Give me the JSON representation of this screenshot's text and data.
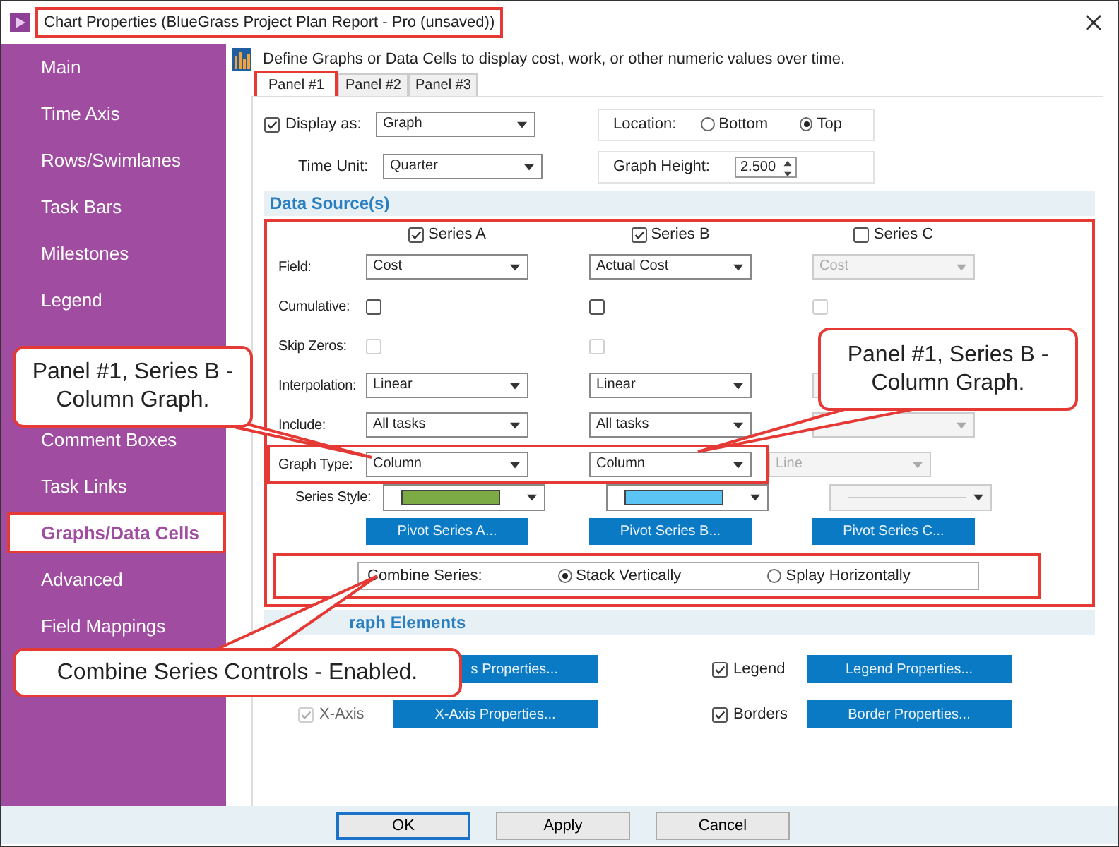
{
  "window": {
    "title": "Chart Properties (BlueGrass Project Plan Report - Pro (unsaved))",
    "highlighted": true
  },
  "sidebar": {
    "items": [
      {
        "label": "Main",
        "selected": false
      },
      {
        "label": "Time Axis",
        "selected": false
      },
      {
        "label": "Rows/Swimlanes",
        "selected": false
      },
      {
        "label": "Task Bars",
        "selected": false
      },
      {
        "label": "Milestones",
        "selected": false
      },
      {
        "label": "Legend",
        "selected": false
      },
      {
        "label": "Comment Boxes",
        "selected": false
      },
      {
        "label": "Task Links",
        "selected": false
      },
      {
        "label": "Graphs/Data Cells",
        "selected": true
      },
      {
        "label": "Advanced",
        "selected": false
      },
      {
        "label": "Field Mappings",
        "selected": false
      }
    ]
  },
  "intro": "Define Graphs or Data Cells to display cost, work, or other numeric values over time.",
  "tabs": [
    {
      "label": "Panel #1",
      "selected": true
    },
    {
      "label": "Panel #2",
      "selected": false
    },
    {
      "label": "Panel #3",
      "selected": false
    }
  ],
  "display": {
    "checked": true,
    "label": "Display as:",
    "value": "Graph"
  },
  "time_unit": {
    "label": "Time Unit:",
    "value": "Quarter"
  },
  "location": {
    "label": "Location:",
    "options": [
      {
        "label": "Bottom",
        "selected": false
      },
      {
        "label": "Top",
        "selected": true
      }
    ]
  },
  "graph_height": {
    "label": "Graph Height:",
    "value": "2.500"
  },
  "data_sources": {
    "title": "Data Source(s)",
    "highlighted": true,
    "rows": [
      {
        "kind": "header",
        "cells": [
          {
            "label": "Series A",
            "checked": true
          },
          {
            "label": "Series B",
            "checked": true
          },
          {
            "label": "Series C",
            "checked": false
          }
        ]
      },
      {
        "kind": "dropdown",
        "label": "Field:",
        "highlighted": false,
        "cells": [
          {
            "value": "Cost",
            "disabled": false
          },
          {
            "value": "Actual Cost",
            "disabled": false
          },
          {
            "value": "Cost",
            "disabled": true
          }
        ]
      },
      {
        "kind": "checkbox",
        "label": "Cumulative:",
        "highlighted": false,
        "cells": [
          {
            "checked": false,
            "disabled": false
          },
          {
            "checked": false,
            "disabled": false
          },
          {
            "checked": false,
            "disabled": true
          }
        ]
      },
      {
        "kind": "checkbox",
        "label": "Skip Zeros:",
        "highlighted": false,
        "cells": [
          {
            "checked": false,
            "disabled": true
          },
          {
            "checked": false,
            "disabled": true
          }
        ]
      },
      {
        "kind": "dropdown",
        "label": "Interpolation:",
        "highlighted": false,
        "cells": [
          {
            "value": "Linear",
            "disabled": false
          },
          {
            "value": "Linear",
            "disabled": false
          },
          {
            "disabled": true
          }
        ]
      },
      {
        "kind": "dropdown",
        "label": "Include:",
        "highlighted": false,
        "cells": [
          {
            "value": "All tasks",
            "disabled": false
          },
          {
            "value": "All tasks",
            "disabled": false
          },
          {
            "disabled": true
          }
        ]
      },
      {
        "kind": "dropdown",
        "label": "Graph Type:",
        "highlighted": true,
        "cells": [
          {
            "value": "Column",
            "disabled": false
          },
          {
            "value": "Column",
            "disabled": false
          },
          {
            "value": "Line",
            "disabled": true
          }
        ]
      },
      {
        "kind": "style",
        "label": "Series Style:",
        "highlighted": false,
        "cells": [
          {
            "color": "#7cab45",
            "disabled": false
          },
          {
            "color": "#5bc4f5",
            "disabled": false
          },
          {
            "disabled": true
          }
        ]
      },
      {
        "kind": "button",
        "cells": [
          {
            "label": "Pivot Series A..."
          },
          {
            "label": "Pivot Series B..."
          },
          {
            "label": "Pivot Series C..."
          }
        ]
      }
    ],
    "combine": {
      "label": "Combine Series:",
      "highlighted": true,
      "options": [
        {
          "label": "Stack Vertically",
          "selected": true
        },
        {
          "label": "Splay Horizontally",
          "selected": false
        }
      ]
    }
  },
  "graph_elements": {
    "title": "raph Elements",
    "items": [
      {
        "button": "s Properties..."
      },
      {
        "label": "Legend",
        "checked": true,
        "disabled": false,
        "button": "Legend Properties..."
      },
      {
        "label": "X-Axis",
        "checked": true,
        "disabled": true,
        "button": "X-Axis Properties..."
      },
      {
        "label": "Borders",
        "checked": true,
        "disabled": false,
        "button": "Border Properties..."
      }
    ]
  },
  "buttons": [
    {
      "label": "OK",
      "default": true
    },
    {
      "label": "Apply",
      "default": false
    },
    {
      "label": "Cancel",
      "default": false
    }
  ],
  "callouts": [
    {
      "text": "Panel #1, Series B - Column Graph."
    },
    {
      "text": "Panel #1, Series B - Column Graph."
    },
    {
      "text": "Combine Series Controls - Enabled."
    }
  ]
}
